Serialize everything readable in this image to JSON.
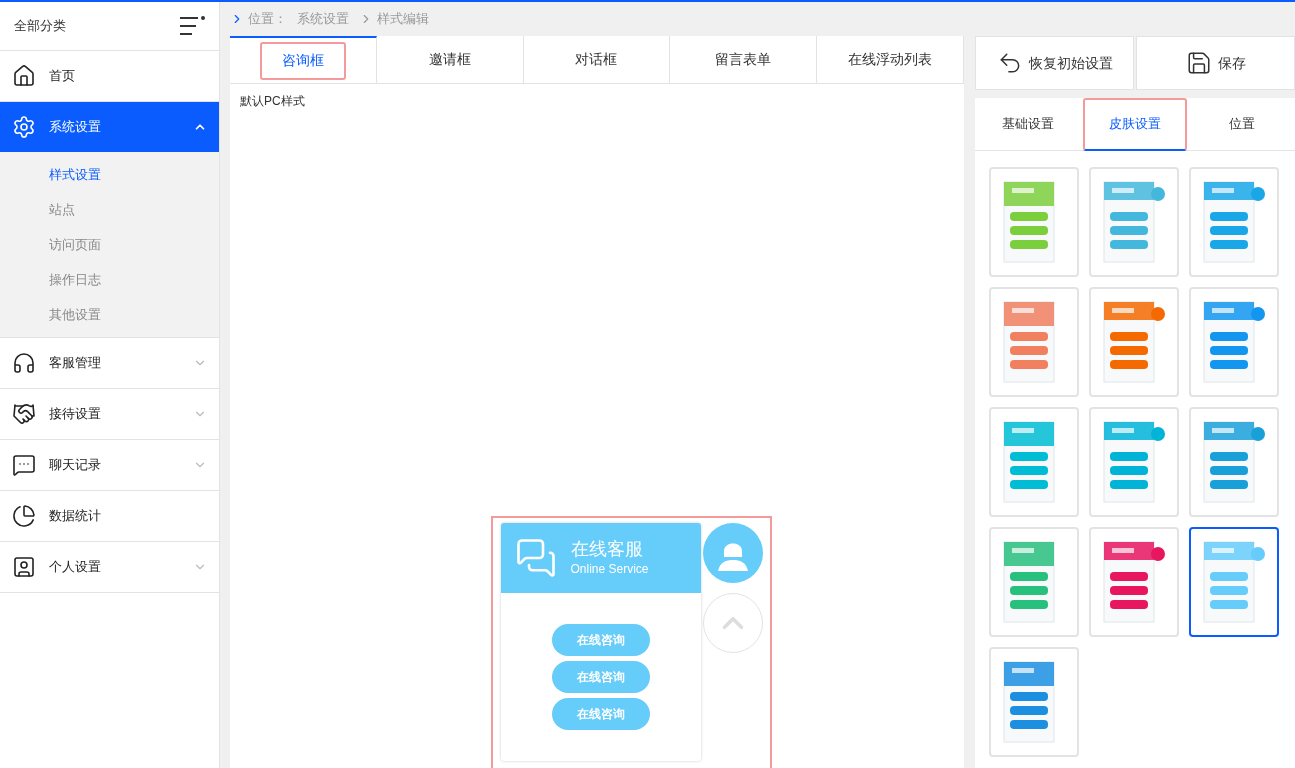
{
  "sidebar": {
    "title": "全部分类",
    "items": [
      {
        "label": "首页",
        "selected": false
      },
      {
        "label": "系统设置",
        "selected": true,
        "expanded": true,
        "children": [
          {
            "label": "样式设置",
            "selected": true
          },
          {
            "label": "站点",
            "selected": false
          },
          {
            "label": "访问页面",
            "selected": false
          },
          {
            "label": "操作日志",
            "selected": false
          },
          {
            "label": "其他设置",
            "selected": false
          }
        ]
      },
      {
        "label": "客服管理",
        "selected": false,
        "expanded": false
      },
      {
        "label": "接待设置",
        "selected": false,
        "expanded": false
      },
      {
        "label": "聊天记录",
        "selected": false,
        "expanded": false
      },
      {
        "label": "数据统计",
        "selected": false
      },
      {
        "label": "个人设置",
        "selected": false,
        "expanded": false
      }
    ]
  },
  "breadcrumb": [
    "位置：",
    "系统设置",
    "样式编辑"
  ],
  "editor_tabs": [
    {
      "label": "咨询框",
      "selected": true
    },
    {
      "label": "邀请框",
      "selected": false
    },
    {
      "label": "对话框",
      "selected": false
    },
    {
      "label": "留言表单",
      "selected": false
    },
    {
      "label": "在线浮动列表",
      "selected": false
    }
  ],
  "preview": {
    "caption": "默认PC样式",
    "title": "在线客服",
    "subtitle": "Online Service",
    "buttons": [
      "在线咨询",
      "在线咨询",
      "在线咨询"
    ]
  },
  "actions": [
    "恢复初始设置",
    "保存"
  ],
  "settings_tabs": [
    {
      "label": "基础设置",
      "selected": false
    },
    {
      "label": "皮肤设置",
      "selected": true
    },
    {
      "label": "位置",
      "selected": false
    }
  ],
  "skins": [
    {
      "selected": false
    },
    {
      "selected": false
    },
    {
      "selected": false
    },
    {
      "selected": false
    },
    {
      "selected": false
    },
    {
      "selected": false
    },
    {
      "selected": false
    },
    {
      "selected": false
    },
    {
      "selected": false
    },
    {
      "selected": false
    },
    {
      "selected": false
    },
    {
      "selected": true
    },
    {
      "selected": false
    }
  ]
}
